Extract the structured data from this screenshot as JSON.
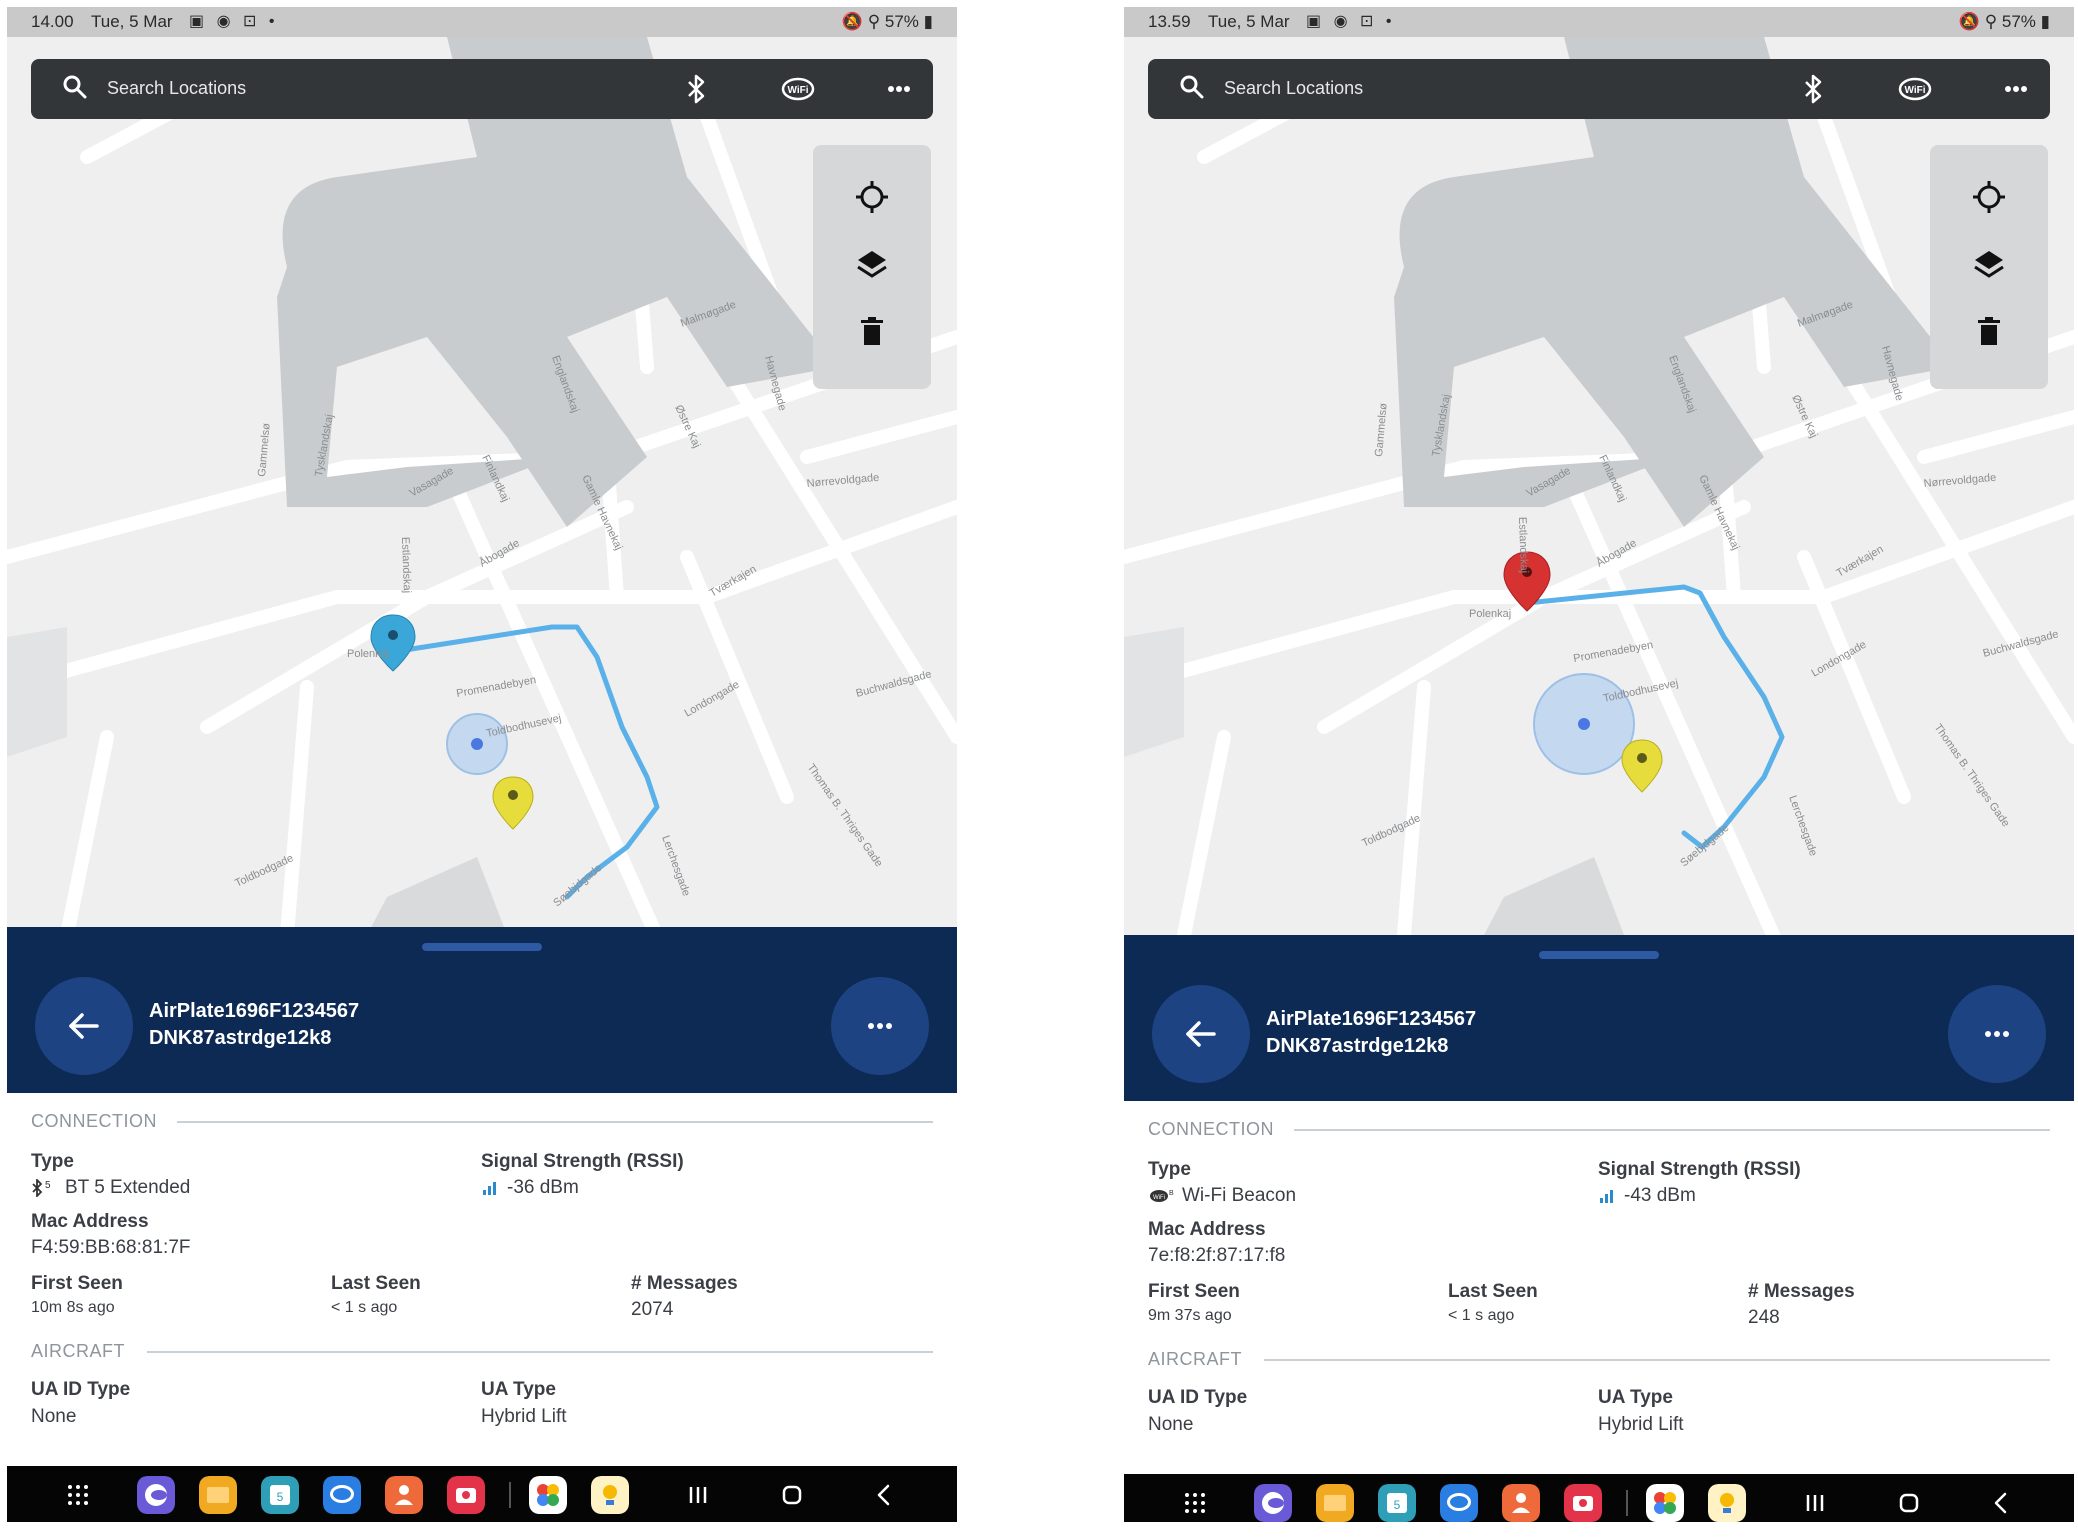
{
  "screens": [
    {
      "status": {
        "time": "14.00",
        "date": "Tue, 5 Mar",
        "icons": "▣ ◉ ⊡ •",
        "right": "🔕 ⚲ 57% ▮"
      },
      "search": {
        "placeholder": "Search Locations"
      },
      "map_labels": [
        "Englandskaj",
        "Malmøgade",
        "Nørrevoldgade",
        "Vasagade",
        "Finlandkaj",
        "Åbogade",
        "Gamle Havnekaj",
        "Promenadebyen",
        "Toldbodhusevej",
        "Londongade",
        "Buchwaldsgade",
        "Toldbodgade",
        "Søebjdgade",
        "Lerchesgade",
        "Thomas B. Thriges Gade",
        "Polenkaj",
        "Estlandskaj",
        "Tysklandskaj",
        "Gammelsø",
        "Havnegade",
        "Østre Kaj",
        "Tværkajen"
      ],
      "sheet": {
        "title": "AirPlate1696F1234567",
        "subtitle": "DNK87astrdge12k8"
      },
      "connection": {
        "heading": "CONNECTION",
        "type_label": "Type",
        "type_value": "BT 5 Extended",
        "type_icon": "bluetooth-5-icon",
        "rssi_label": "Signal Strength (RSSI)",
        "rssi_value": "-36 dBm",
        "mac_label": "Mac Address",
        "mac_value": "F4:59:BB:68:81:7F",
        "first_seen_label": "First Seen",
        "first_seen_value": "10m 8s ago",
        "last_seen_label": "Last Seen",
        "last_seen_value": "< 1 s ago",
        "messages_label": "# Messages",
        "messages_value": "2074"
      },
      "aircraft": {
        "heading": "AIRCRAFT",
        "ua_id_type_label": "UA ID Type",
        "ua_id_type_value": "None",
        "ua_type_label": "UA Type",
        "ua_type_value": "Hybrid Lift"
      },
      "pin_color": "#3aa7d8"
    },
    {
      "status": {
        "time": "13.59",
        "date": "Tue, 5 Mar",
        "icons": "▣ ◉ ⊡ •",
        "right": "🔕 ⚲ 57% ▮"
      },
      "search": {
        "placeholder": "Search Locations"
      },
      "map_labels": [
        "Englandskaj",
        "Malmøgade",
        "Nørrevoldgade",
        "Vasagade",
        "Finlandkaj",
        "Åbogade",
        "Gamle Havnekaj",
        "Promenadebyen",
        "Toldbodhusevej",
        "Londongade",
        "Buchwaldsgade",
        "Toldbodgade",
        "Søebjdgade",
        "Lerchesgade",
        "Thomas B. Thriges Gade",
        "Polenkaj",
        "Estlandskaj",
        "Tysklandskaj",
        "Gammelsø",
        "Havnegade",
        "Østre Kaj",
        "Tværkajen"
      ],
      "sheet": {
        "title": "AirPlate1696F1234567",
        "subtitle": "DNK87astrdge12k8"
      },
      "connection": {
        "heading": "CONNECTION",
        "type_label": "Type",
        "type_value": "Wi-Fi Beacon",
        "type_icon": "wifi-beacon-icon",
        "rssi_label": "Signal Strength (RSSI)",
        "rssi_value": "-43 dBm",
        "mac_label": "Mac Address",
        "mac_value": "7e:f8:2f:87:17:f8",
        "first_seen_label": "First Seen",
        "first_seen_value": "9m 37s ago",
        "last_seen_label": "Last Seen",
        "last_seen_value": "< 1 s ago",
        "messages_label": "# Messages",
        "messages_value": "248"
      },
      "aircraft": {
        "heading": "AIRCRAFT",
        "ua_id_type_label": "UA ID Type",
        "ua_id_type_value": "None",
        "ua_type_label": "UA Type",
        "ua_type_value": "Hybrid Lift"
      },
      "pin_color": "#d63232"
    }
  ],
  "colors": {
    "sheet": "#0d2a55",
    "button": "#1d4383",
    "route": "#5ab0e8",
    "water": "#c9ccce",
    "user_dot": "#4a78e0",
    "pilot_pin": "#e6dc3c"
  },
  "navbar_apps": [
    "apps-grid-icon",
    "internet-icon",
    "files-icon",
    "calendar-icon",
    "messages-icon",
    "contacts-icon",
    "camera-icon",
    "photos-icon",
    "tips-icon",
    "recents-icon",
    "home-icon",
    "back-icon"
  ]
}
